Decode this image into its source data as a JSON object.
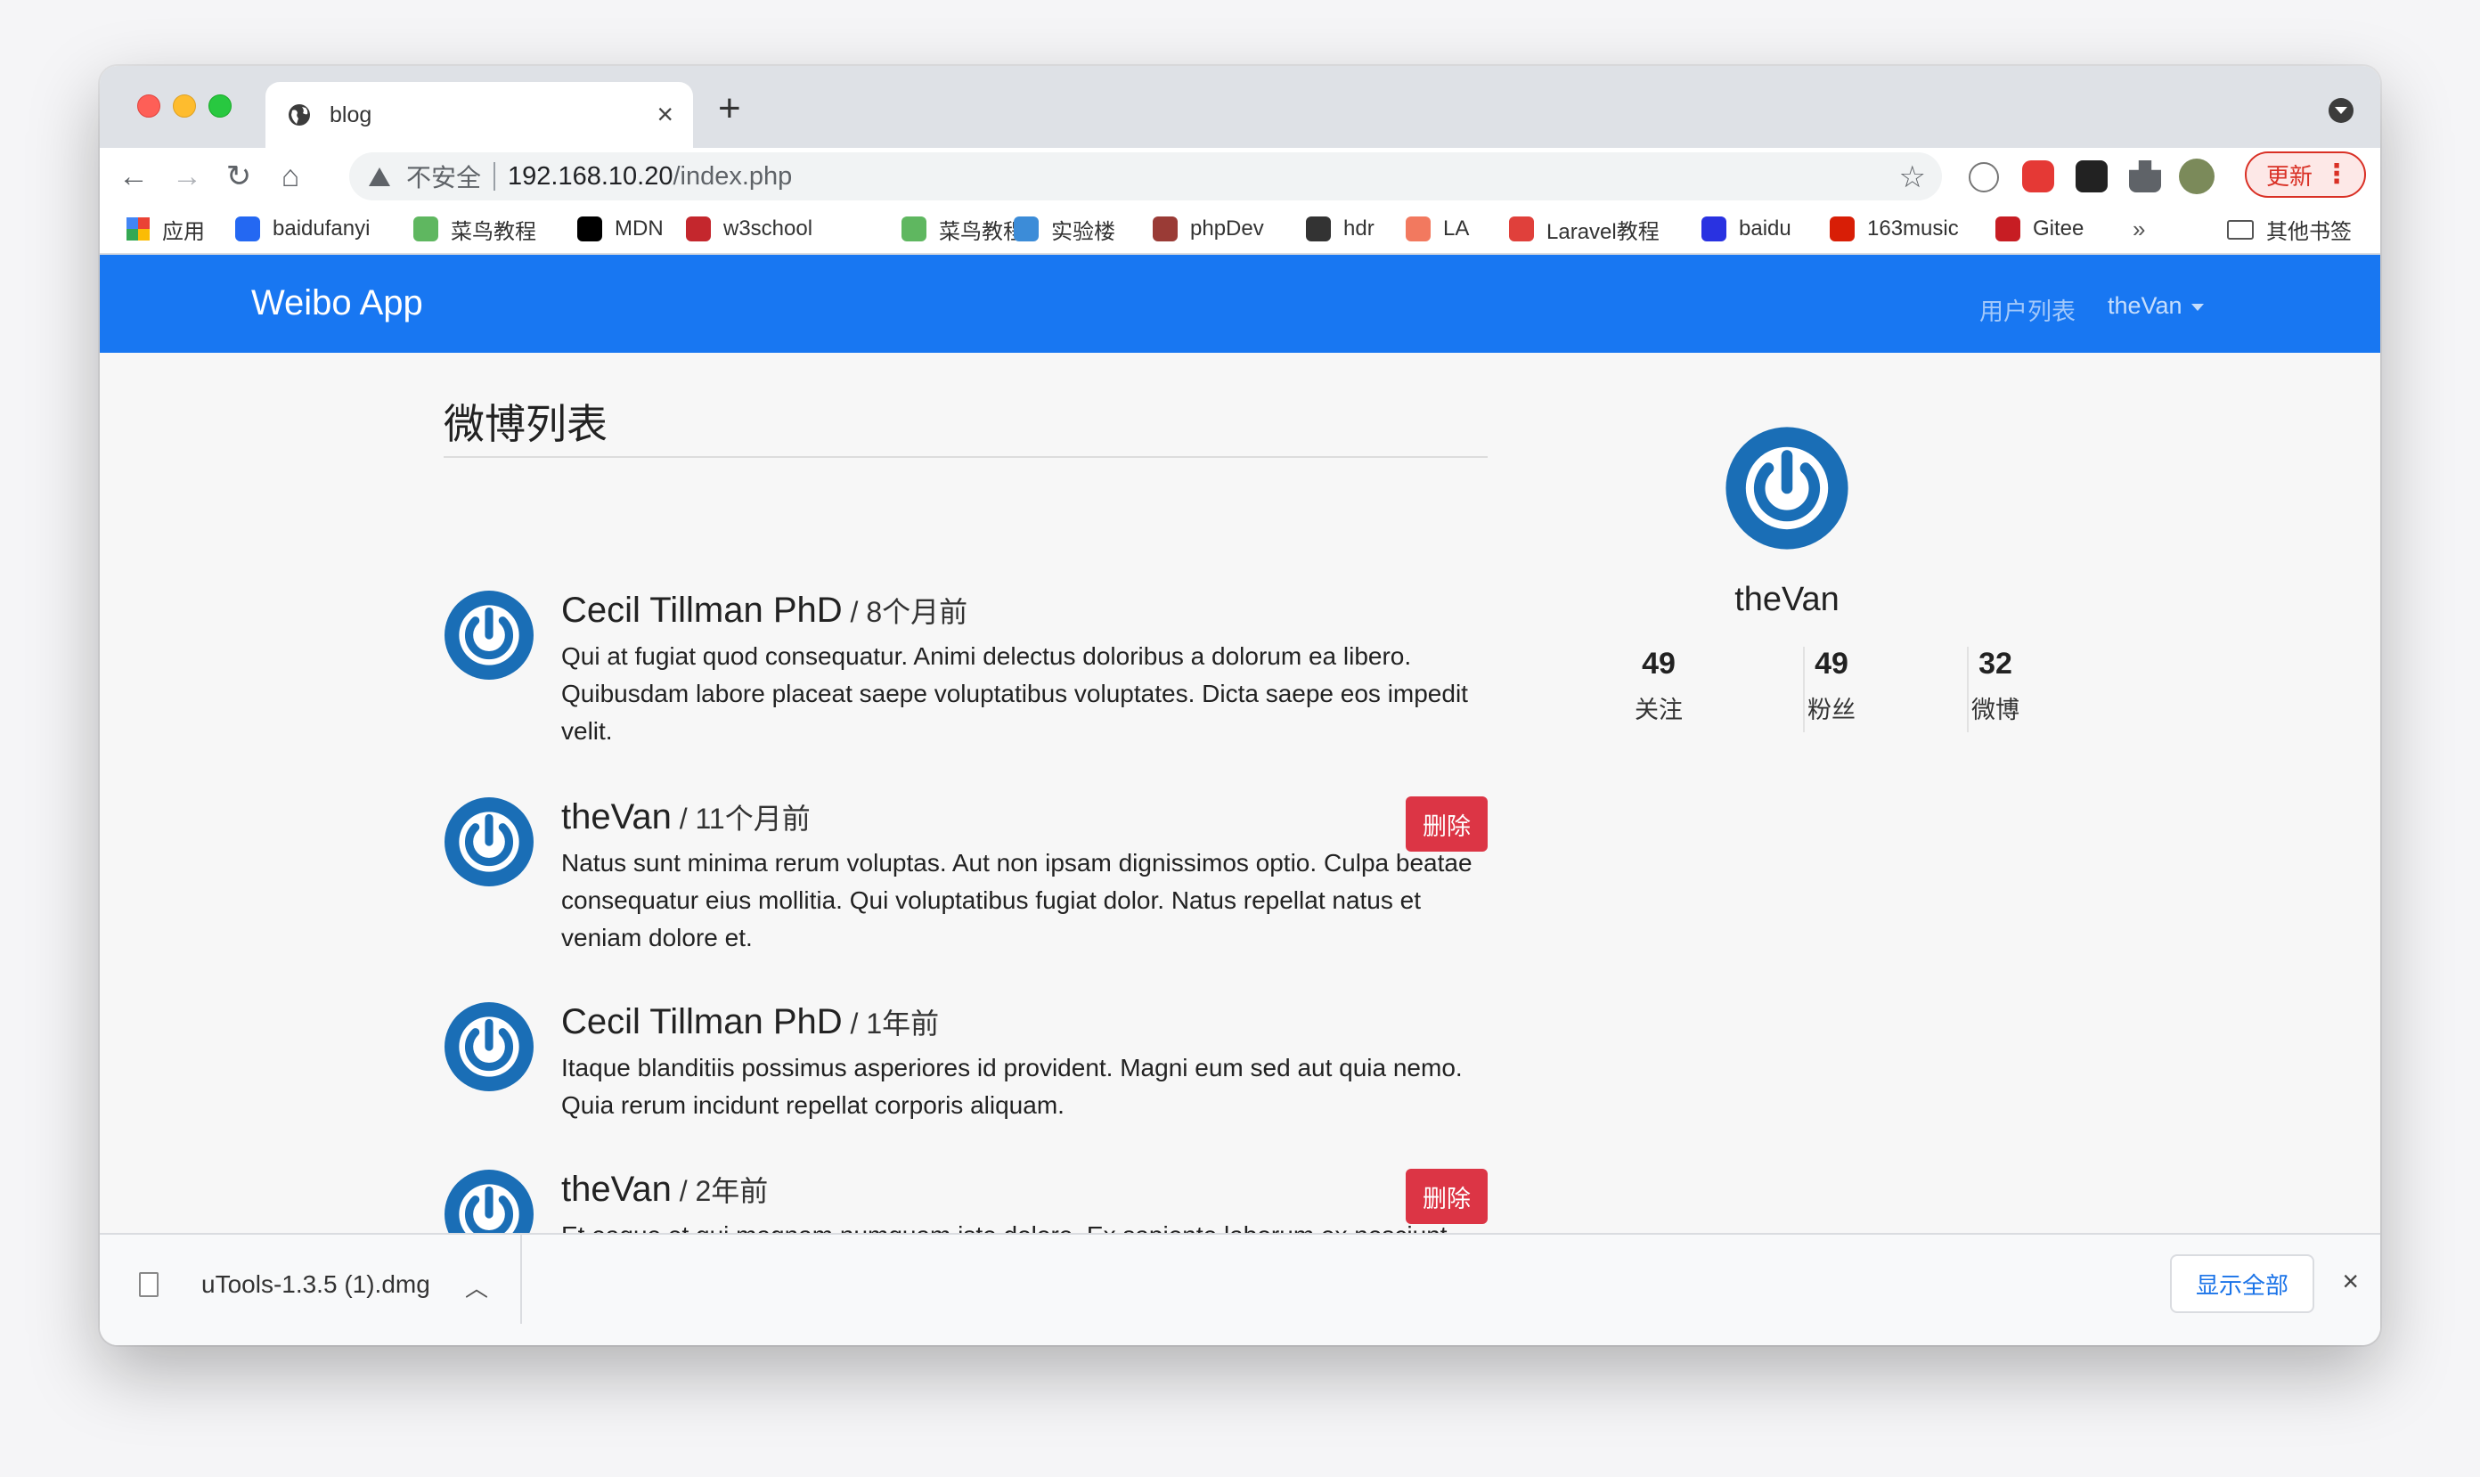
{
  "browser": {
    "tab_title": "blog",
    "tab_close": "×",
    "new_tab": "+",
    "insecure_label": "不安全",
    "url_host": "192.168.10.20",
    "url_path": "/index.php",
    "update_label": "更新",
    "update_menu": "⋮"
  },
  "bookmarks": {
    "apps_label": "应用",
    "items": [
      {
        "label": "baidufanyi",
        "color": "#2468f2"
      },
      {
        "label": "菜鸟教程",
        "color": "#5fb760"
      },
      {
        "label": "MDN",
        "color": "#000000"
      },
      {
        "label": "w3school",
        "color": "#c4272d"
      },
      {
        "label": "菜鸟教程",
        "color": "#5fb760"
      },
      {
        "label": "实验楼",
        "color": "#3c8cd8"
      },
      {
        "label": "phpDev",
        "color": "#9a3b36"
      },
      {
        "label": "hdr",
        "color": "#333333"
      },
      {
        "label": "LA",
        "color": "#f2795f"
      },
      {
        "label": "Laravel教程",
        "color": "#e0403b"
      },
      {
        "label": "baidu",
        "color": "#2932e1"
      },
      {
        "label": "163music",
        "color": "#d81e06"
      },
      {
        "label": "Gitee",
        "color": "#c71d23"
      }
    ],
    "more": "»",
    "other_label": "其他书签"
  },
  "navbar": {
    "brand": "Weibo App",
    "users_link": "用户列表",
    "user_menu": "theVan"
  },
  "feed": {
    "heading": "微博列表",
    "posts": [
      {
        "author": "Cecil Tillman PhD",
        "time": " / 8个月前",
        "body": "Qui at fugiat quod consequatur. Animi delectus doloribus a dolorum ea libero. Quibusdam labore placeat saepe voluptatibus voluptates. Dicta saepe eos impedit velit."
      },
      {
        "author": "theVan",
        "time": " / 11个月前",
        "body": "Natus sunt minima rerum voluptas. Aut non ipsam dignissimos optio. Culpa beatae consequatur eius mollitia. Qui voluptatibus fugiat dolor. Natus repellat natus et veniam dolore et.",
        "delete_label": "删除"
      },
      {
        "author": "Cecil Tillman PhD",
        "time": " / 1年前",
        "body": "Itaque blanditiis possimus asperiores id provident. Magni eum sed aut quia nemo. Quia rerum incidunt repellat corporis aliquam."
      },
      {
        "author": "theVan",
        "time": " / 2年前",
        "body": "Et eaque et qui magnam numquam iste dolore. Ex sapiente laborum ex nesciunt odit qui nam. Tempore sapiente voluptatem dolores dolorum aut quia ut recusandae.",
        "delete_label": "删除"
      }
    ]
  },
  "profile": {
    "name": "theVan",
    "stats": [
      {
        "num": "49",
        "label": "关注"
      },
      {
        "num": "49",
        "label": "粉丝"
      },
      {
        "num": "32",
        "label": "微博"
      }
    ]
  },
  "downloads": {
    "file_name": "uTools-1.3.5 (1).dmg",
    "show_all": "显示全部",
    "close": "×"
  },
  "colors": {
    "navbar": "#1877f2",
    "delete": "#dc3545",
    "avatar_ring": "#1a6eb6"
  }
}
